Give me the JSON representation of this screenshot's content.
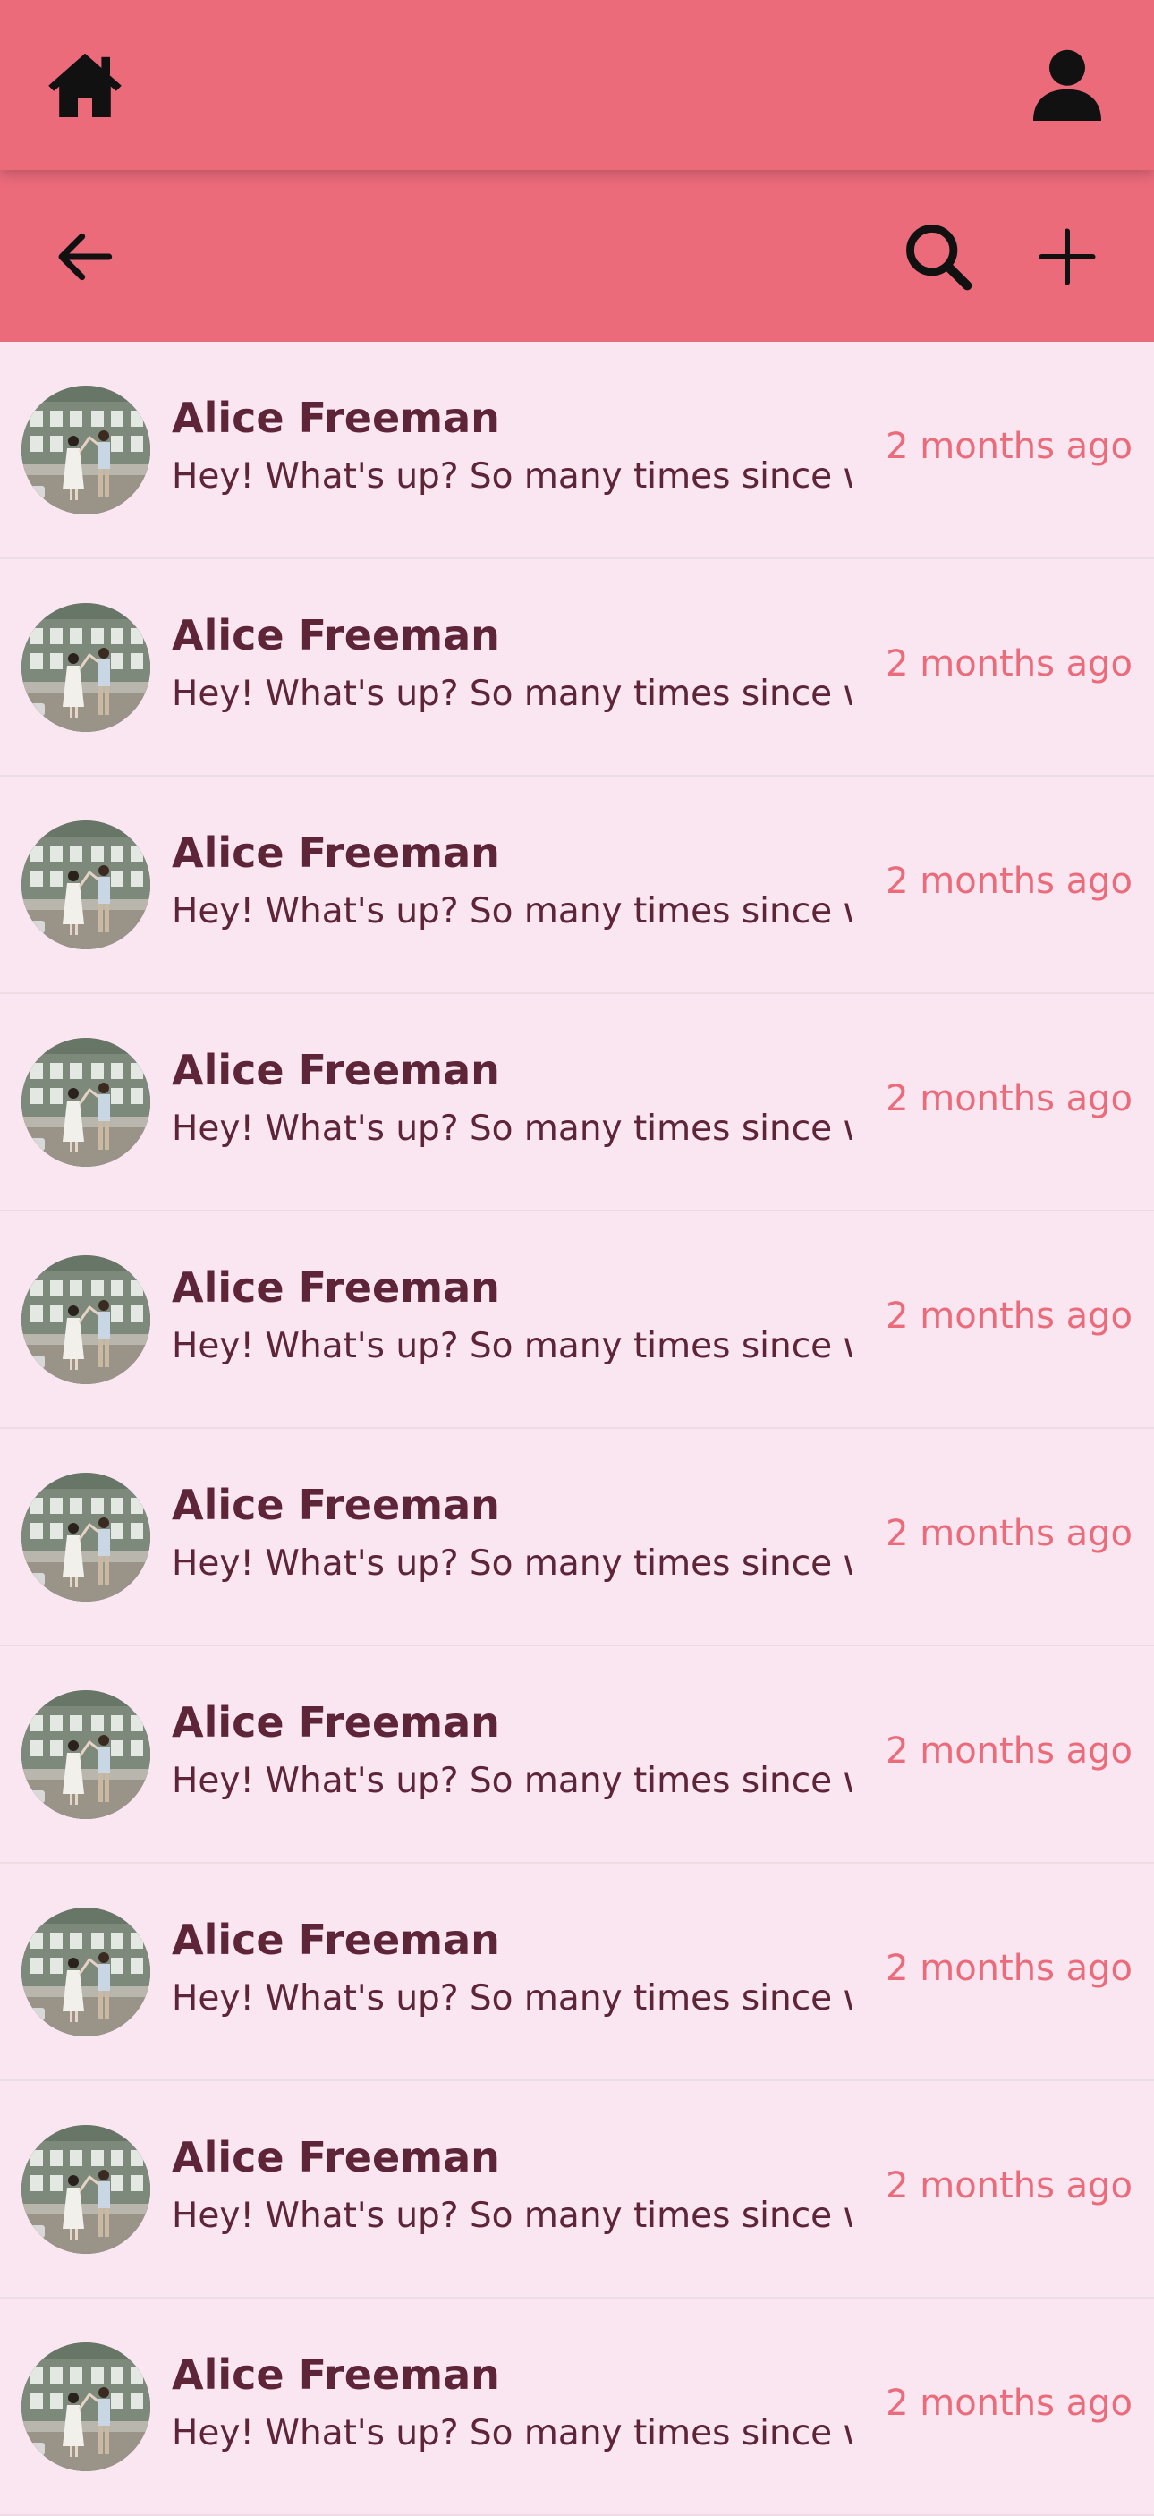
{
  "header": {
    "home_icon": "home-icon",
    "profile_icon": "person-icon"
  },
  "toolbar": {
    "back_icon": "arrow-left-icon",
    "search_icon": "search-icon",
    "add_icon": "plus-icon"
  },
  "colors": {
    "appbar": "#eb6b7b",
    "background": "#f9e6f1",
    "name_text": "#5e2438",
    "timestamp": "#eb6b7b",
    "icon": "#111111"
  },
  "conversations": [
    {
      "name": "Alice Freeman",
      "preview": "Hey! What's up? So many times since we",
      "time": "2 months ago"
    },
    {
      "name": "Alice Freeman",
      "preview": "Hey! What's up? So many times since we",
      "time": "2 months ago"
    },
    {
      "name": "Alice Freeman",
      "preview": "Hey! What's up? So many times since we",
      "time": "2 months ago"
    },
    {
      "name": "Alice Freeman",
      "preview": "Hey! What's up? So many times since we",
      "time": "2 months ago"
    },
    {
      "name": "Alice Freeman",
      "preview": "Hey! What's up? So many times since we",
      "time": "2 months ago"
    },
    {
      "name": "Alice Freeman",
      "preview": "Hey! What's up? So many times since we",
      "time": "2 months ago"
    },
    {
      "name": "Alice Freeman",
      "preview": "Hey! What's up? So many times since we",
      "time": "2 months ago"
    },
    {
      "name": "Alice Freeman",
      "preview": "Hey! What's up? So many times since we",
      "time": "2 months ago"
    },
    {
      "name": "Alice Freeman",
      "preview": "Hey! What's up? So many times since we",
      "time": "2 months ago"
    },
    {
      "name": "Alice Freeman",
      "preview": "Hey! What's up? So many times since we",
      "time": "2 months ago"
    }
  ]
}
